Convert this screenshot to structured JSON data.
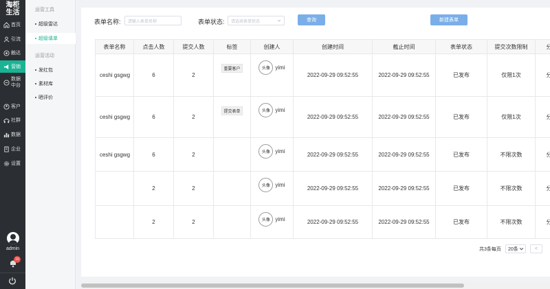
{
  "brand": {
    "line1": "淘柜",
    "line2": "生活"
  },
  "nav": {
    "home": "首页",
    "traffic": "引流",
    "reach": "触达",
    "marketing": "营销",
    "data_center_1": "数据",
    "data_center_2": "中台",
    "customers": "客户",
    "community": "社群",
    "data": "数据",
    "enterprise": "企业",
    "settings": "设置",
    "user": "admin",
    "notifications_count": "10"
  },
  "subnav": {
    "section_tools": "运营工具",
    "super_radar": "超级雷达",
    "super_form": "超级填单",
    "section_activities": "运营活动",
    "red_packet": "发红包",
    "material_library": "素材库",
    "review": "晒评价"
  },
  "filters": {
    "form_name_label": "表单名称:",
    "form_name_placeholder": "请输入表单名称",
    "form_status_label": "表单状态:",
    "form_status_placeholder": "请选择表单状态",
    "query_button": "查询",
    "new_form_button": "新建表单"
  },
  "table": {
    "headers": [
      "表单名称",
      "点击人数",
      "提交人数",
      "标签",
      "创建人",
      "创建时间",
      "截止时间",
      "表单状态",
      "提交次数限制",
      "分"
    ],
    "rows": [
      {
        "name": "ceshi gsgwg",
        "clicks": "6",
        "submits": "2",
        "tag": "重要客户",
        "avatar": "头像",
        "creator": "yimi",
        "created": "2022-09-29 09:52:55",
        "deadline": "2022-09-29 09:52:55",
        "status": "已发布",
        "limit": "仅限1次",
        "extra": "分"
      },
      {
        "name": "ceshi gsgwg",
        "clicks": "6",
        "submits": "2",
        "tag": "提交表单",
        "avatar": "头像",
        "creator": "yimi",
        "created": "2022-09-29 09:52:55",
        "deadline": "2022-09-29 09:52:55",
        "status": "已发布",
        "limit": "仅限1次",
        "extra": "分"
      },
      {
        "name": "ceshi gsgwg",
        "clicks": "6",
        "submits": "2",
        "tag": "",
        "avatar": "头像",
        "creator": "yimi",
        "created": "2022-09-29 09:52:55",
        "deadline": "2022-09-29 09:52:55",
        "status": "已发布",
        "limit": "不限次数",
        "extra": "分"
      },
      {
        "name": "",
        "clicks": "2",
        "submits": "2",
        "tag": "",
        "avatar": "头像",
        "creator": "yimi",
        "created": "2022-09-29 09:52:55",
        "deadline": "2022-09-29 09:52:55",
        "status": "已发布",
        "limit": "不限次数",
        "extra": "分"
      },
      {
        "name": "",
        "clicks": "2",
        "submits": "2",
        "tag": "",
        "avatar": "头像",
        "creator": "yimi",
        "created": "2022-09-29 09:52:55",
        "deadline": "2022-09-29 09:52:55",
        "status": "已发布",
        "limit": "不限次数",
        "extra": "分"
      }
    ]
  },
  "pager": {
    "total": "共3条每页",
    "page_size": "20条",
    "prev": "<"
  },
  "colors": {
    "accent": "#1ab394",
    "primary_button": "#7aaee8",
    "sidebar_bg": "#2b2f33",
    "badge": "#e8504b"
  }
}
